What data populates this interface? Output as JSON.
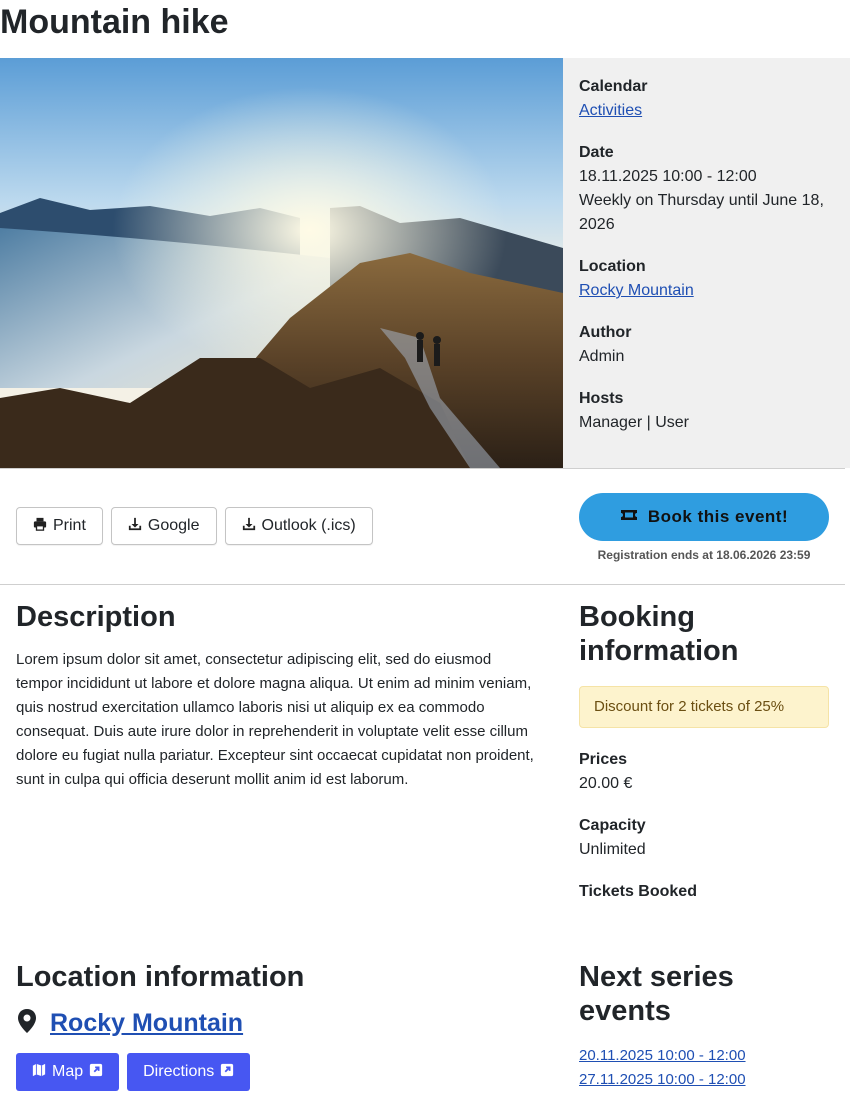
{
  "event": {
    "title": "Mountain hike"
  },
  "info": {
    "calendar_label": "Calendar",
    "calendar_value": "Activities",
    "date_label": "Date",
    "date_value": "18.11.2025 10:00 - 12:00",
    "recurrence": "Weekly on Thursday until June 18, 2026",
    "location_label": "Location",
    "location_value": "Rocky Mountain",
    "author_label": "Author",
    "author_value": "Admin",
    "hosts_label": "Hosts",
    "hosts_value": "Manager | User"
  },
  "actions": {
    "print_label": "Print",
    "google_label": "Google",
    "outlook_label": "Outlook (.ics)",
    "print_icon": "printer-icon",
    "download_icon": "download-icon"
  },
  "booking_cta": {
    "label": "Book this event!",
    "icon": "ticket-icon",
    "registration_note": "Registration ends at 18.06.2026 23:59"
  },
  "description": {
    "title": "Description",
    "text": "Lorem ipsum dolor sit amet, consectetur adipiscing elit, sed do eiusmod tempor incididunt ut labore et dolore magna aliqua. Ut enim ad minim veniam, quis nostrud exercitation ullamco laboris nisi ut aliquip ex ea commodo consequat. Duis aute irure dolor in reprehenderit in voluptate velit esse cillum dolore eu fugiat nulla pariatur. Excepteur sint occaecat cupidatat non proident, sunt in culpa qui officia deserunt mollit anim id est laborum."
  },
  "booking_info": {
    "title": "Booking information",
    "discount": "Discount for 2 tickets of 25%",
    "prices_label": "Prices",
    "prices_value": "20.00 €",
    "capacity_label": "Capacity",
    "capacity_value": "Unlimited",
    "tickets_booked_label": "Tickets Booked"
  },
  "location_info": {
    "title": "Location information",
    "name": "Rocky Mountain",
    "map_label": "Map",
    "directions_label": "Directions",
    "pin_icon": "map-pin-icon"
  },
  "series": {
    "title": "Next series events",
    "events": [
      "20.11.2025 10:00 - 12:00",
      "27.11.2025 10:00 - 12:00"
    ]
  },
  "colors": {
    "link": "#1f4fb3",
    "book_button": "#2f9de0",
    "map_buttons": "#4757f2",
    "info_panel_bg": "#f0f0f0",
    "alert_bg": "#fdf3cd"
  }
}
